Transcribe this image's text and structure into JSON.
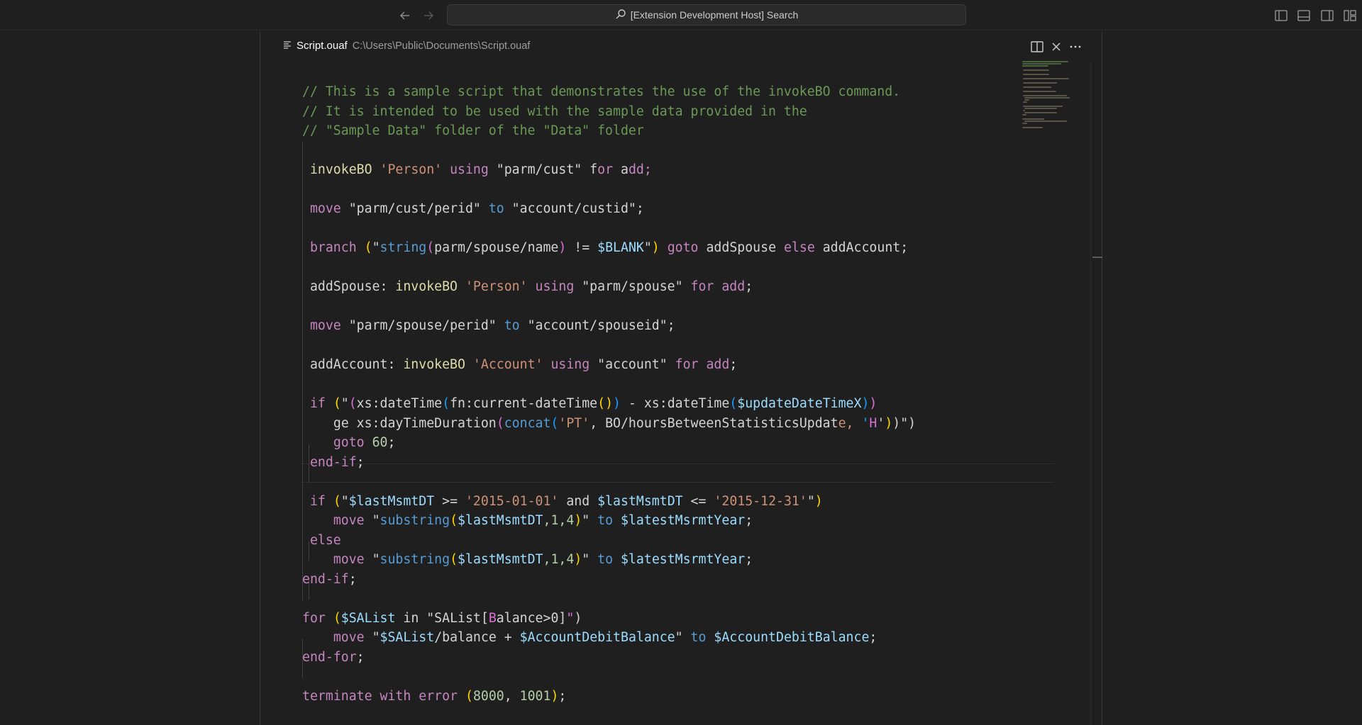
{
  "titlebar": {
    "back_icon": "arrow-left-icon",
    "forward_icon": "arrow-right-icon",
    "search_icon": "search-icon",
    "search_label": "[Extension Development Host] Search",
    "layout_icons": [
      "toggle-primary-sidebar-icon",
      "toggle-panel-icon",
      "toggle-secondary-sidebar-icon",
      "customize-layout-icon"
    ]
  },
  "tab": {
    "icon": "file-lines-icon",
    "filename": "Script.ouaf",
    "path": "C:\\Users\\Public\\Documents\\Script.ouaf",
    "actions": [
      "split-editor-icon",
      "close-icon",
      "more-actions-icon"
    ]
  },
  "editor": {
    "lines": [
      "// This is a sample script that demonstrates the use of the invokeBO command.",
      "// It is intended to be used with the sample data provided in the",
      "// \"Sample Data\" folder of the \"Data\" folder",
      "",
      " invokeBO 'Person' using \"parm/cust\" for add;",
      "",
      " move \"parm/cust/perid\" to \"account/custid\";",
      "",
      " branch (\"string(parm/spouse/name) != $BLANK\") goto addSpouse else addAccount;",
      "",
      " addSpouse: invokeBO 'Person' using \"parm/spouse\" for add;",
      "",
      " move \"parm/spouse/perid\" to \"account/spouseid\";",
      "",
      " addAccount: invokeBO 'Account' using \"account\" for add;",
      "",
      " if (\"(xs:dateTime(fn:current-dateTime()) - xs:dateTime($updateDateTimeX))",
      "    ge xs:dayTimeDuration(concat('PT', BO/hoursBetweenStatisticsUpdate, 'H'))\")",
      "    goto 60;",
      " end-if;",
      "",
      " if (\"$lastMsmtDT >= '2015-01-01' and $lastMsmtDT <= '2015-12-31'\")",
      "    move \"substring($lastMsmtDT,1,4)\" to $latestMsrmtYear;",
      " else",
      "    move \"substring($lastMsmtDT,1,4)\" to $latestMsrmtYear;",
      "end-if;",
      "",
      "for ($SAList in \"SAList[Balance>0]\")",
      "    move \"$SAList/balance + $AccountDebitBalance\" to $AccountDebitBalance;",
      "end-for;",
      "",
      "terminate with error (8000, 1001);"
    ]
  },
  "colors": {
    "comment": "#6a9955",
    "keyword": "#c586c0",
    "function": "#dcdcaa",
    "string": "#ce9178",
    "blue_keyword": "#569cd6",
    "variable": "#9cdcfe",
    "number": "#b5cea8"
  }
}
